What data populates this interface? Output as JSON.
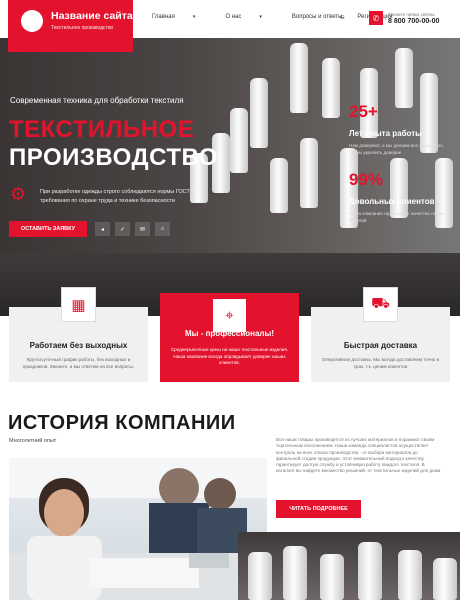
{
  "header": {
    "site_name": "Название сайта",
    "site_tagline": "Текстильное производство",
    "nav": [
      {
        "label": "Главная",
        "has_dropdown": true
      },
      {
        "label": "О нас",
        "has_dropdown": true
      },
      {
        "label": "Вопросы и ответы",
        "has_dropdown": false
      },
      {
        "label": "Регистрация",
        "has_dropdown": false
      }
    ],
    "phone_label": "Звоните прямо сейчас",
    "phone": "8 800 700-00-00"
  },
  "hero": {
    "subtitle": "Современная техника для обработки текстиля",
    "title_line1": "ТЕКСТИЛЬНОЕ",
    "title_line2": "ПРОИЗВОДСТВО",
    "text": "При разработке одежды строго соблюдаются нормы ГОСТ и требования по охране труда и технике безопасности",
    "cta_label": "ОСТАВИТЬ ЗАЯВКУ",
    "stats": [
      {
        "number": "25+",
        "label": "Лет опыта работы",
        "text": "Нам доверяют, и мы делаем все возможное, чтобы укрепить доверие"
      },
      {
        "number": "99%",
        "label": "Довольных клиентов",
        "text": "Наша компания гарантирует качество наших изделий"
      }
    ]
  },
  "features": [
    {
      "icon": "calendar-icon",
      "title": "Работаем без выходных",
      "text": "Круглосуточный график работы, без выходных и праздников. Звоните, и мы ответим на все вопросы."
    },
    {
      "icon": "location-icon",
      "title": "Мы - профессионалы!",
      "text": "Среднерыночные цены на наши текстильные изделия. Наша компания всегда оправдывает доверие наших клиентов."
    },
    {
      "icon": "delivery-icon",
      "title": "Быстрая доставка",
      "text": "Оперативная доставка. Мы всегда доставляем точно в срок, т.к. ценим клиентов"
    }
  ],
  "history": {
    "title": "ИСТОРИЯ КОМПАНИИ",
    "subtitle": "Многолетний опыт",
    "text": "Все наши товары производятся из лучших материалов и поражают своим тщательным исполнением. Наша команда специалистов осуществляет контроль на всех этапах производства - от выбора материалов до финальной стадии продукции. Этот внимательный подход к качеству гарантирует долгую службу и устойчивую работу каждого текстиля. В каталоге вы найдете множество решений, от текстильных изделий для дома",
    "button_label": "ЧИТАТЬ ПОДРОБНЕЕ"
  },
  "colors": {
    "accent": "#e3132d",
    "dark": "#1a1a1a",
    "card_bg": "#f0f0f0"
  }
}
